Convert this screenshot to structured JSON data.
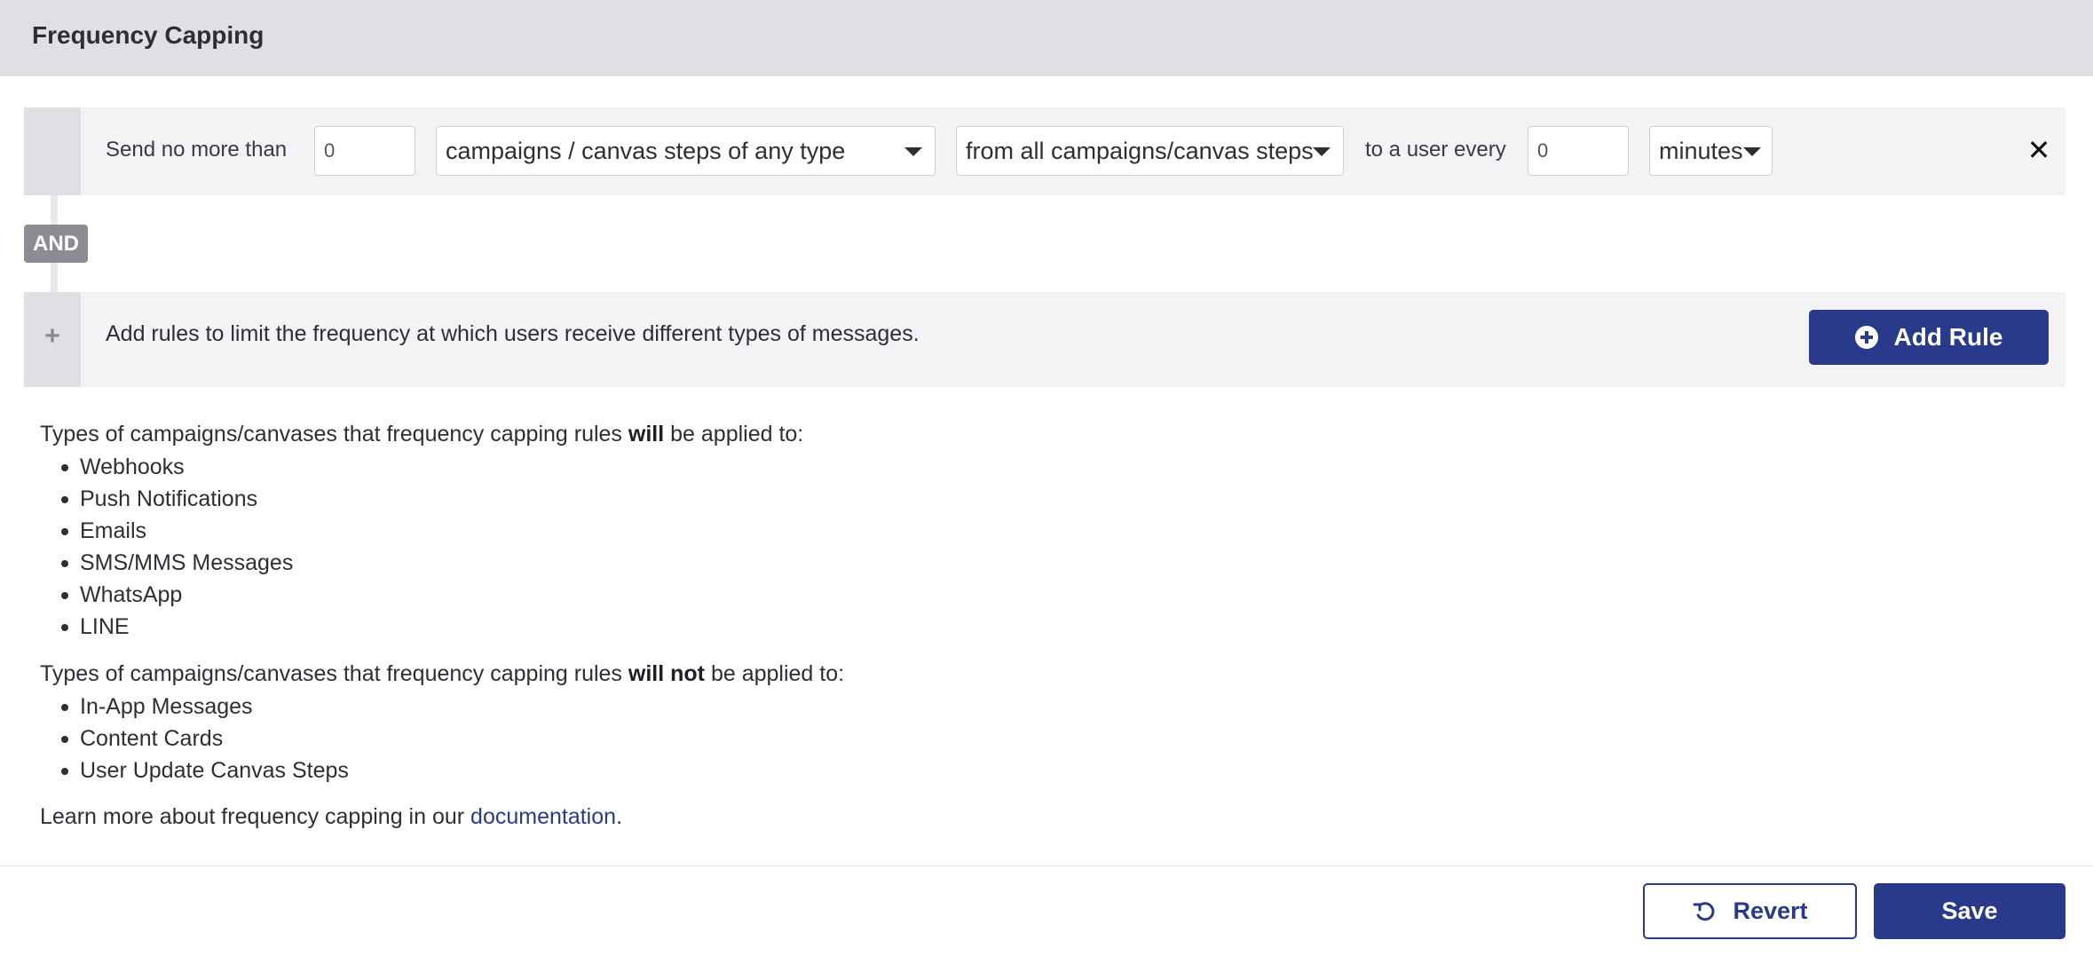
{
  "header": {
    "title": "Frequency Capping"
  },
  "rule": {
    "send_label": "Send no more than",
    "count_value": "0",
    "message_type": "campaigns / canvas steps of any type",
    "source": "from all campaigns/canvas steps",
    "user_label": "to a user every",
    "period_value": "0",
    "period_unit": "minutes"
  },
  "connector": {
    "label": "AND"
  },
  "add_rule": {
    "description": "Add rules to limit the frequency at which users receive different types of messages.",
    "button_label": "Add Rule"
  },
  "applied": {
    "prefix": "Types of campaigns/canvases that frequency capping rules ",
    "emphasis": "will",
    "suffix": " be applied to:",
    "items": [
      "Webhooks",
      "Push Notifications",
      "Emails",
      "SMS/MMS Messages",
      "WhatsApp",
      "LINE"
    ]
  },
  "not_applied": {
    "prefix": "Types of campaigns/canvases that frequency capping rules ",
    "emphasis": "will not",
    "suffix": " be applied to:",
    "items": [
      "In-App Messages",
      "Content Cards",
      "User Update Canvas Steps"
    ]
  },
  "learn_more": {
    "prefix": "Learn more about frequency capping in our ",
    "link": "documentation",
    "suffix": "."
  },
  "footer": {
    "revert_label": "Revert",
    "save_label": "Save"
  },
  "icons": {
    "close": "close-icon",
    "plus": "plus-icon",
    "add": "plus-circle-icon",
    "revert": "undo-icon"
  },
  "colors": {
    "primary": "#2a3a8a",
    "header_bg": "#dfdfe4",
    "row_bg": "#f3f3f5"
  }
}
